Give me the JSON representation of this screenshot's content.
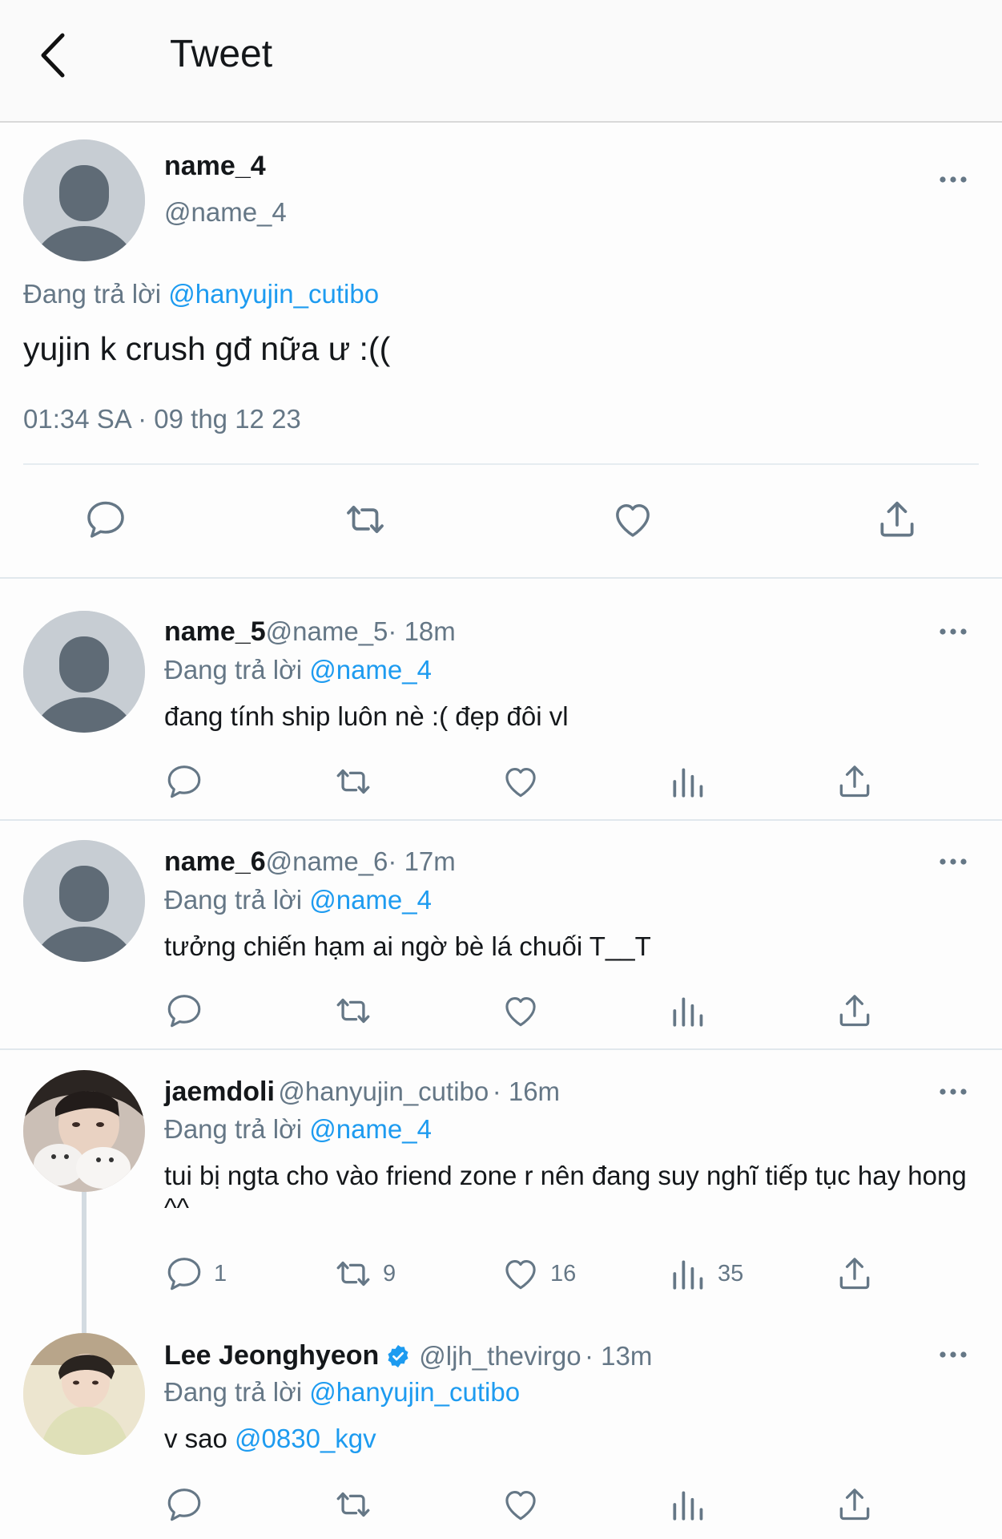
{
  "header": {
    "title": "Tweet"
  },
  "main_tweet": {
    "name": "name_4",
    "handle": "@name_4",
    "replying_prefix": "Đang trả lời ",
    "replying_to": "@hanyujin_cutibo",
    "text": "yujin k crush gđ nữa ư :((",
    "timestamp": "01:34 SA · 09 thg 12 23"
  },
  "replies": [
    {
      "name": "name_5",
      "handle": "@name_5",
      "time": "· 18m",
      "replying_prefix": "Đang trả lời ",
      "replying_to": "@name_4",
      "text": "đang tính ship luôn nè :( đẹp đôi vl"
    },
    {
      "name": "name_6",
      "handle": "@name_6",
      "time": "· 17m",
      "replying_prefix": "Đang trả lời ",
      "replying_to": "@name_4",
      "text": "tưởng chiến hạm ai ngờ bè lá chuối T__T"
    },
    {
      "name": "jaemdoli",
      "handle": "@hanyujin_cutibo",
      "time": "· 16m",
      "replying_prefix": "Đang trả lời ",
      "replying_to": "@name_4",
      "text": "tui bị ngta cho vào friend zone r nên đang suy nghĩ tiếp tục hay hong ^^",
      "counts": {
        "replies": "1",
        "retweets": "9",
        "likes": "16",
        "views": "35"
      }
    },
    {
      "name": "Lee Jeonghyeon",
      "handle": "@ljh_thevirgo",
      "time": "· 13m",
      "replying_prefix": "Đang trả lời ",
      "replying_to": "@hanyujin_cutibo",
      "text_prefix": "v sao ",
      "text_mention": "@0830_kgv"
    }
  ],
  "colors": {
    "link": "#1d9bf0",
    "muted": "#657786",
    "text": "#14171a",
    "verified": "#1d9bf0",
    "avatar_bg": "#c7cdd3",
    "avatar_fg": "#5f6b76"
  },
  "icons": [
    "back-arrow-icon",
    "more-icon",
    "reply-icon",
    "retweet-icon",
    "like-icon",
    "share-icon",
    "views-icon",
    "verified-icon"
  ]
}
